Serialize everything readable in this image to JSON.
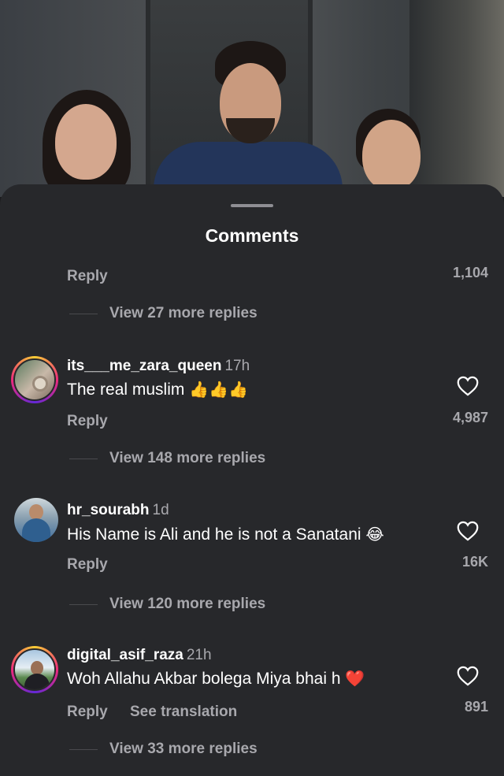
{
  "sheet": {
    "title": "Comments"
  },
  "top_comment": {
    "reply_label": "Reply",
    "likes": "1,104",
    "view_replies": "View 27 more replies"
  },
  "comments": [
    {
      "username": "its___me_zara_queen",
      "time": "17h",
      "text": "The real muslim",
      "emoji": "👍👍👍",
      "reply_label": "Reply",
      "likes": "4,987",
      "view_replies": "View 148 more replies",
      "has_story_ring": true
    },
    {
      "username": "hr_sourabh",
      "time": "1d",
      "text": "His Name is Ali and he is not a Sanatani",
      "emoji": "😂",
      "reply_label": "Reply",
      "likes": "16K",
      "view_replies": "View 120 more replies",
      "has_story_ring": false
    },
    {
      "username": "digital_asif_raza",
      "time": "21h",
      "text": "Woh Allahu Akbar bolega Miya bhai h",
      "emoji": "❤️",
      "reply_label": "Reply",
      "translation_label": "See translation",
      "likes": "891",
      "view_replies": "View 33 more replies",
      "has_story_ring": true
    }
  ],
  "icons": {
    "heart": "heart-outline-icon",
    "handle": "drag-handle"
  },
  "colors": {
    "sheet_bg": "#27282b",
    "secondary_text": "#a8a8ad",
    "primary_text": "#ffffff"
  }
}
